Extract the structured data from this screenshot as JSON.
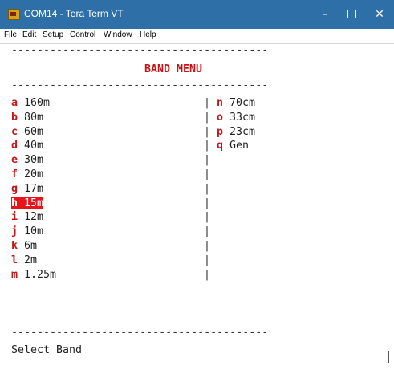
{
  "window": {
    "title": "COM14 - Tera Term VT",
    "controls": {
      "minimize": "–",
      "close": "✕"
    }
  },
  "menubar": {
    "items": [
      "File",
      "Edit",
      "Setup",
      "Control",
      "Window",
      "Help"
    ]
  },
  "terminal": {
    "divider": "----------------------------------------",
    "menu_title": "BAND MENU",
    "left_items": [
      {
        "key": "a",
        "label": "160m"
      },
      {
        "key": "b",
        "label": "80m"
      },
      {
        "key": "c",
        "label": "60m"
      },
      {
        "key": "d",
        "label": "40m"
      },
      {
        "key": "e",
        "label": "30m"
      },
      {
        "key": "f",
        "label": "20m"
      },
      {
        "key": "g",
        "label": "17m"
      },
      {
        "key": "h",
        "label": "15m"
      },
      {
        "key": "i",
        "label": "12m"
      },
      {
        "key": "j",
        "label": "10m"
      },
      {
        "key": "k",
        "label": "6m"
      },
      {
        "key": "l",
        "label": "2m"
      },
      {
        "key": "m",
        "label": "1.25m"
      }
    ],
    "separator": "|",
    "right_items": [
      {
        "key": "n",
        "label": "70cm"
      },
      {
        "key": "o",
        "label": "33cm"
      },
      {
        "key": "p",
        "label": "23cm"
      },
      {
        "key": "q",
        "label": "Gen"
      }
    ],
    "selected_key": "h",
    "prompt": "Select Band"
  },
  "colors": {
    "titlebar": "#2f6fa8",
    "menu_key": "#c41616",
    "selection_bg": "#e8141a"
  }
}
